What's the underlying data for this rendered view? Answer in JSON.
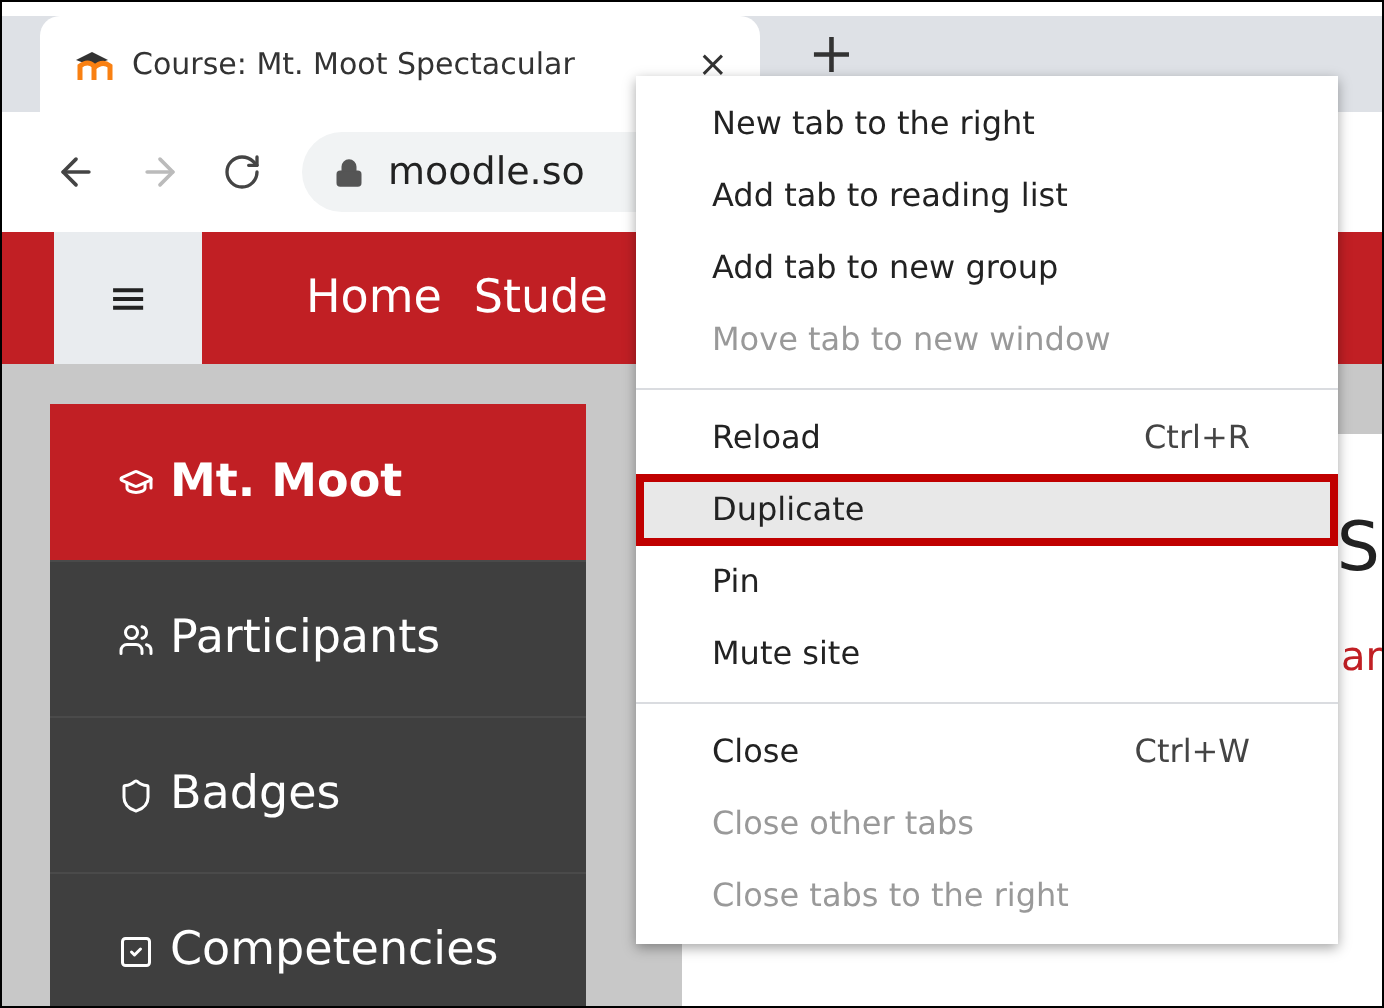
{
  "tab": {
    "title": "Course: Mt. Moot Spectacular",
    "close": "×"
  },
  "new_tab": "+",
  "address": {
    "value": "moodle.so"
  },
  "navbar": {
    "menu": "≡",
    "links": [
      "Home",
      "Stude"
    ]
  },
  "sidebar": {
    "items": [
      {
        "label": "Mt. Moot",
        "selected": true,
        "kind": "course"
      },
      {
        "label": "Participants",
        "selected": false,
        "kind": "people"
      },
      {
        "label": "Badges",
        "selected": false,
        "kind": "badge"
      },
      {
        "label": "Competencies",
        "selected": false,
        "kind": "check"
      }
    ]
  },
  "main": {
    "heading_fragment": "S",
    "link_fragment": "ar"
  },
  "context_menu": {
    "groups": [
      [
        {
          "label": "New tab to the right",
          "disabled": false,
          "selected": false
        },
        {
          "label": "Add tab to reading list",
          "disabled": false,
          "selected": false
        },
        {
          "label": "Add tab to new group",
          "disabled": false,
          "selected": false
        },
        {
          "label": "Move tab to new window",
          "disabled": true,
          "selected": false
        }
      ],
      [
        {
          "label": "Reload",
          "shortcut": "Ctrl+R",
          "disabled": false,
          "selected": false
        },
        {
          "label": "Duplicate",
          "disabled": false,
          "selected": true
        },
        {
          "label": "Pin",
          "disabled": false,
          "selected": false
        },
        {
          "label": "Mute site",
          "disabled": false,
          "selected": false
        }
      ],
      [
        {
          "label": "Close",
          "shortcut": "Ctrl+W",
          "disabled": false,
          "selected": false
        },
        {
          "label": "Close other tabs",
          "disabled": true,
          "selected": false
        },
        {
          "label": "Close tabs to the right",
          "disabled": true,
          "selected": false
        }
      ]
    ]
  }
}
